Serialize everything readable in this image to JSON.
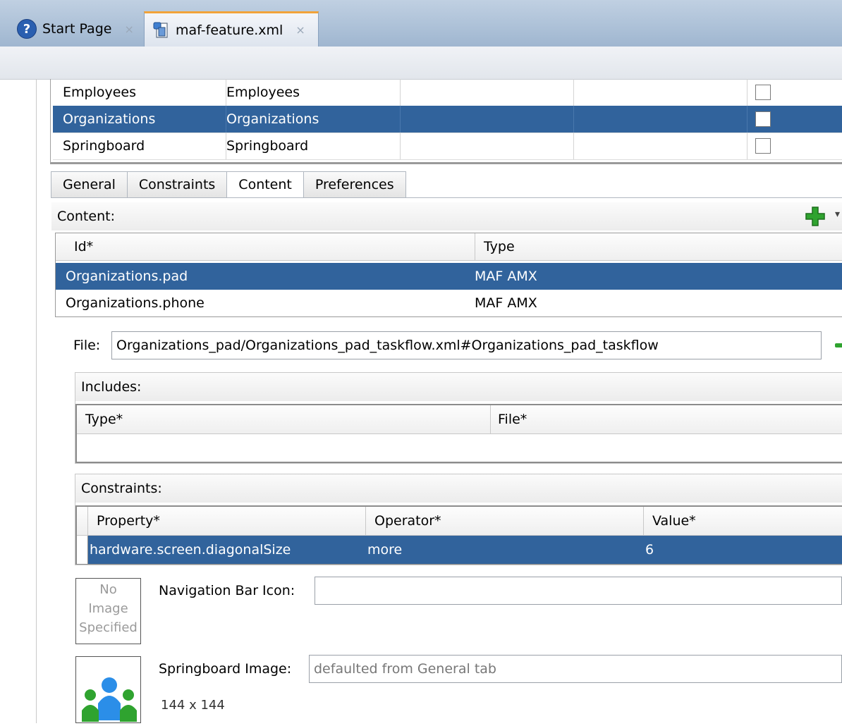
{
  "tabs": [
    {
      "label": "Start Page",
      "icon": "help-icon",
      "active": false
    },
    {
      "label": "maf-feature.xml",
      "icon": "xml-file-icon",
      "active": true
    }
  ],
  "close_glyph": "×",
  "features": [
    {
      "id": "Employees",
      "name": "Employees",
      "selected": false
    },
    {
      "id": "Organizations",
      "name": "Organizations",
      "selected": true
    },
    {
      "id": "Springboard",
      "name": "Springboard",
      "selected": false
    }
  ],
  "subtabs": [
    "General",
    "Constraints",
    "Content",
    "Preferences"
  ],
  "active_subtab": "Content",
  "content": {
    "section_label": "Content:",
    "columns": [
      "Id*",
      "Type"
    ],
    "rows": [
      {
        "id": "Organizations.pad",
        "type": "MAF AMX",
        "selected": true
      },
      {
        "id": "Organizations.phone",
        "type": "MAF AMX",
        "selected": false
      }
    ]
  },
  "file": {
    "label": "File:",
    "value": "Organizations_pad/Organizations_pad_taskflow.xml#Organizations_pad_taskflow"
  },
  "includes": {
    "label": "Includes:",
    "columns": [
      "Type*",
      "File*"
    ]
  },
  "constraints": {
    "label": "Constraints:",
    "columns": [
      "Property*",
      "Operator*",
      "Value*"
    ],
    "rows": [
      {
        "property": "hardware.screen.diagonalSize",
        "operator": "more",
        "value": "6",
        "selected": true
      }
    ]
  },
  "navigation_bar_icon": {
    "label": "Navigation Bar Icon:",
    "value": "",
    "placeholder_lines": [
      "No",
      "Image",
      "Specified"
    ]
  },
  "springboard_image": {
    "label": "Springboard Image:",
    "placeholder": "defaulted from General tab",
    "size": "144 x 144"
  },
  "colors": {
    "selection": "#31639c",
    "tab_accent": "#f2a33a",
    "add_icon": "#2fa32f"
  }
}
